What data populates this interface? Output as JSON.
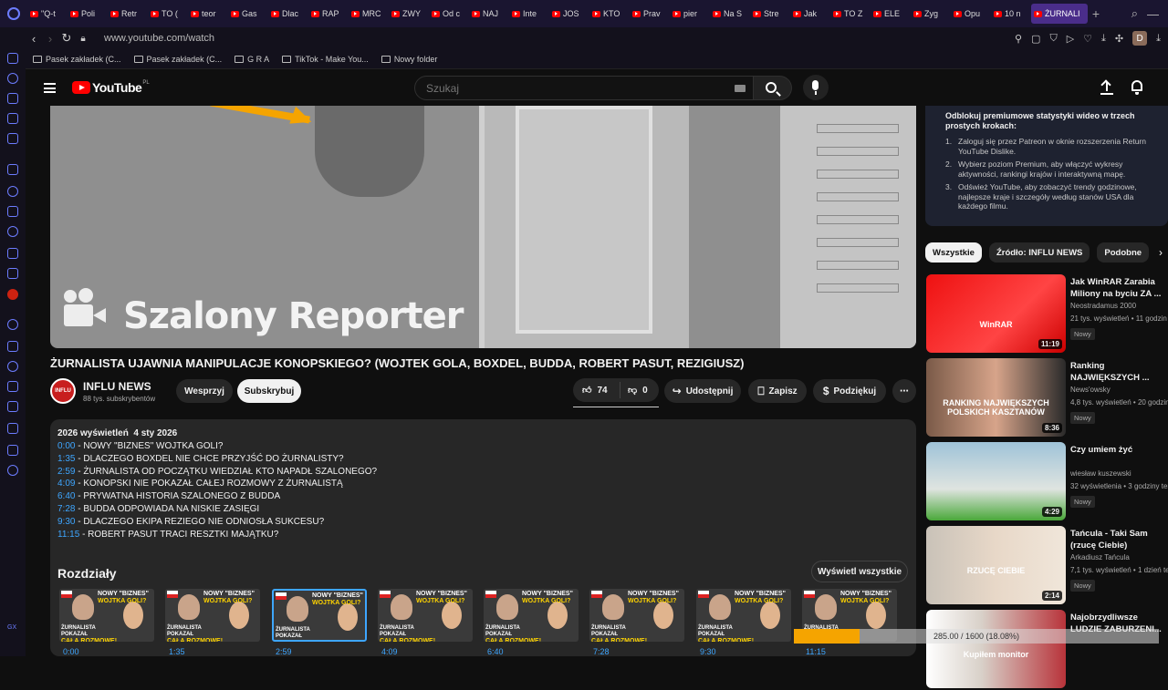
{
  "browser": {
    "tabs": [
      "\"Q-t",
      "Poli",
      "Retr",
      "TO (",
      "teor",
      "Gas",
      "Dlac",
      "RAP",
      "MRC",
      "ZWY",
      "Od c",
      "NAJ",
      "Inte",
      "JOS",
      "KTO",
      "Prav",
      "pier",
      "Na S",
      "Stre",
      "Jak",
      "TO Z",
      "ELE",
      "Zyg",
      "Opu",
      "10 n"
    ],
    "active_tab": "ŻURNALI",
    "url": "www.youtube.com/watch",
    "profile_initial": "D",
    "bookmarks": [
      "Pasek zakładek (C...",
      "Pasek zakładek (C...",
      "G R A",
      "TikTok - Make You...",
      "Nowy folder"
    ]
  },
  "sidebar": {
    "bottom_label": "GX",
    "yt_badge": "Z"
  },
  "youtube": {
    "logo_text": "YouTube",
    "country": "PL",
    "search_placeholder": "Szukaj"
  },
  "video": {
    "watermark": "Szalony Reporter",
    "title": "ŻURNALISTA UJAWNIA MANIPULACJE KONOPSKIEGO? (WOJTEK GOLA, BOXDEL, BUDDA, ROBERT PASUT, REZIGIUSZ)",
    "channel_name": "INFLU NEWS",
    "channel_avatar_text": "INFLU",
    "subscribers": "88 tys. subskrybentów",
    "buttons": {
      "support": "Wesprzyj",
      "subscribe": "Subskrybuj",
      "likes": "74",
      "dislikes": "0",
      "share": "Udostępnij",
      "save": "Zapisz",
      "thanks": "Podziękuj"
    }
  },
  "description": {
    "views": "2026 wyświetleń",
    "date": "4 sty 2026",
    "timestamps": [
      {
        "time": "0:00",
        "text": " - NOWY \"BIZNES\" WOJTKA GOLI?"
      },
      {
        "time": "1:35",
        "text": " - DLACZEGO BOXDEL NIE CHCE PRZYJŚĆ DO ŻURNALISTY?"
      },
      {
        "time": "2:59",
        "text": " - ŻURNALISTA OD POCZĄTKU WIEDZIAŁ KTO NAPADŁ SZALONEGO?"
      },
      {
        "time": "4:09",
        "text": " - KONOPSKI NIE POKAZAŁ CAŁEJ ROZMOWY Z ŻURNALISTĄ"
      },
      {
        "time": "6:40",
        "text": " - PRYWATNA HISTORIA SZALONEGO Z BUDDA"
      },
      {
        "time": "7:28",
        "text": " - BUDDA ODPOWIADA NA NISKIE ZASIĘGI"
      },
      {
        "time": "9:30",
        "text": " - DLACZEGO EKIPA REZIEGO NIE ODNIOSŁA SUKCESU?"
      },
      {
        "time": "11:15",
        "text": " - ROBERT PASUT TRACI RESZTKI MAJĄTKU?"
      }
    ],
    "chapters_title": "Rozdziały",
    "show_all": "Wyświetl wszystkie",
    "chapter_times": [
      "0:00",
      "1:35",
      "2:59",
      "4:09",
      "6:40",
      "7:28",
      "9:30",
      "11:15"
    ],
    "chapter_thumb": {
      "caption_top": "NOWY \"BIZNES\"",
      "caption_top_highlight": "WOJTKA GOLI?",
      "caption_bottom": "ŻURNALISTA POKAZAŁ",
      "caption_bottom_highlight": "CAŁĄ ROZMOWĘ!"
    }
  },
  "rdl_box": {
    "heading": "Odblokuj premiumowe statystyki wideo w trzech prostych krokach:",
    "steps": [
      "Zaloguj się przez Patreon w oknie rozszerzenia Return YouTube Dislike.",
      "Wybierz poziom Premium, aby włączyć wykresy aktywności, rankingi krajów i interaktywną mapę.",
      "Odśwież YouTube, aby zobaczyć trendy godzinowe, najlepsze kraje i szczegóły według stanów USA dla każdego filmu."
    ]
  },
  "chips": [
    "Wszystkie",
    "Źródło: INFLU NEWS",
    "Podobne"
  ],
  "recommended": [
    {
      "title": "Jak WinRAR Zarabia Miliony na byciu ZA ...",
      "channel": "Neostradamus 2000",
      "meta": "21 tys. wyświetleń • 11 godzin temu",
      "badge": "Nowy",
      "duration": "11:19",
      "thumb_text": "WinRAR"
    },
    {
      "title": "Ranking NAJWIĘKSZYCH ...",
      "channel": "News'owsky",
      "meta": "4,8 tys. wyświetleń • 20 godzin temu",
      "badge": "Nowy",
      "duration": "8:36",
      "thumb_text": "RANKING NAJWIĘKSZYCH POLSKICH KASZTANÓW"
    },
    {
      "title": "Czy umiem żyć",
      "channel": "wiesław kuszewski",
      "meta": "32 wyświetlenia • 3 godziny temu",
      "badge": "Nowy",
      "duration": "4:29",
      "thumb_text": ""
    },
    {
      "title": "Tańcula - Taki Sam (rzucę Ciebie)",
      "channel": "Arkadiusz Tańcula",
      "meta": "7,1 tys. wyświetleń • 1 dzień temu",
      "badge": "Nowy",
      "duration": "2:14",
      "thumb_text": "RZUCĘ CIEBIE"
    },
    {
      "title": "Najobrzydliwsze LUDZIE ZABURZENI...",
      "channel": "",
      "meta": "",
      "badge": "",
      "duration": "",
      "thumb_text": "Kupiłem monitor"
    }
  ],
  "download": {
    "text": "285.00 / 1600 (18.08%)",
    "progress": 0.1808
  },
  "colors": {
    "accent": "#3ea6ff",
    "brand": "#ff0000",
    "progress": "#f5a400"
  }
}
